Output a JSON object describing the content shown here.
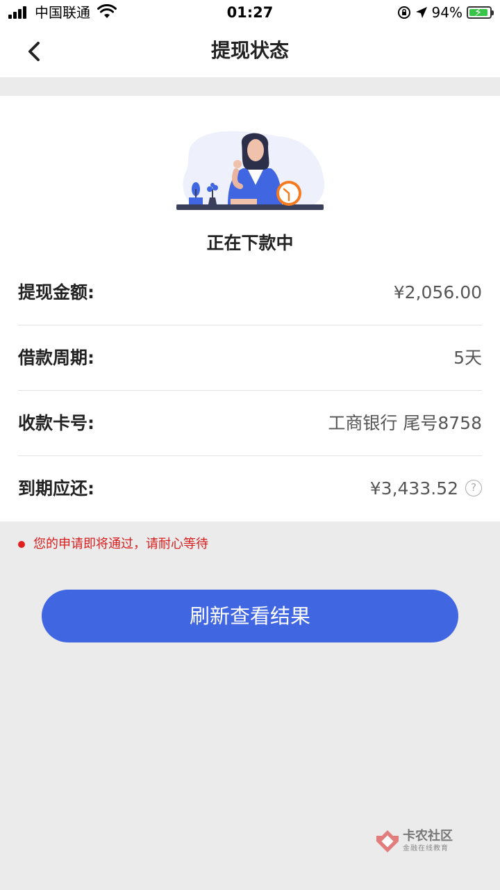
{
  "status_bar": {
    "carrier": "中国联通",
    "time": "01:27",
    "battery": "94%"
  },
  "nav": {
    "title": "提现状态"
  },
  "status": {
    "text": "正在下款中"
  },
  "details": [
    {
      "label": "提现金额:",
      "value": "¥2,056.00"
    },
    {
      "label": "借款周期:",
      "value": "5天"
    },
    {
      "label": "收款卡号:",
      "value": "工商银行 尾号8758"
    },
    {
      "label": "到期应还:",
      "value": "¥3,433.52"
    }
  ],
  "help_glyph": "?",
  "notice": {
    "text": "您的申请即将通过，请耐心等待"
  },
  "actions": {
    "refresh_label": "刷新查看结果"
  },
  "watermark": {
    "title": "卡农社区",
    "subtitle": "金融在线教育"
  },
  "colors": {
    "primary": "#4166e1",
    "notice_red": "#d81e1e",
    "page_bg": "#ebebeb",
    "clock_orange": "#f47b20"
  }
}
